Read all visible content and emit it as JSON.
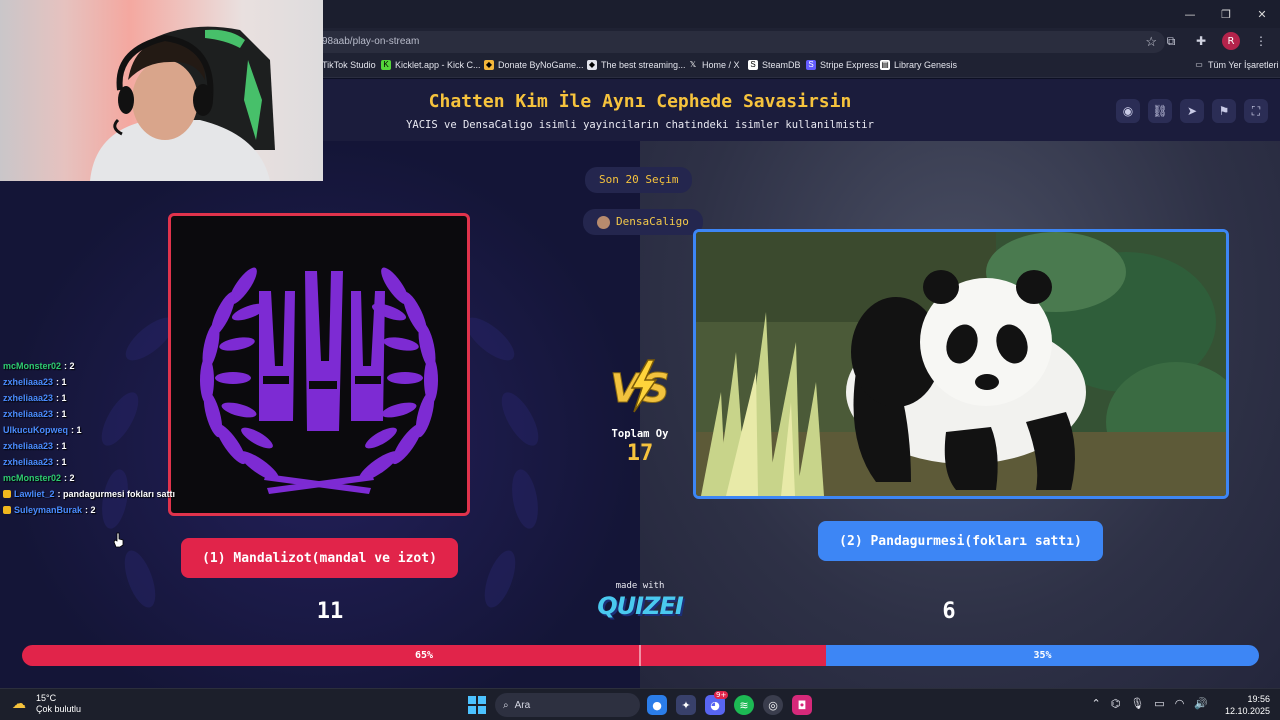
{
  "browser": {
    "url": "98aab/play-on-stream",
    "profile_initial": "R",
    "bookmarks": [
      {
        "label": "TikTok Studio",
        "icon": "tiktok-icon"
      },
      {
        "label": "Kicklet.app - Kick C...",
        "icon": "kicklet-icon"
      },
      {
        "label": "Donate ByNoGame...",
        "icon": "donate-icon"
      },
      {
        "label": "The best streaming...",
        "icon": "streaming-icon"
      },
      {
        "label": "Home / X",
        "icon": "x-icon"
      },
      {
        "label": "SteamDB",
        "icon": "steamdb-icon"
      },
      {
        "label": "Stripe Express",
        "icon": "stripe-icon"
      },
      {
        "label": "Library Genesis",
        "icon": "library-icon"
      }
    ],
    "all_bookmarks": "Tüm Yer İşaretleri"
  },
  "quiz": {
    "title": "Chatten Kim İle Aynı Cephede Savasirsin",
    "subtitle": "YACIS ve DensaCaligo isimli yayincilarin chatindeki isimler kullanilmistir",
    "last_choices": "Son 20 Seçim",
    "streamer": "DensaCaligo",
    "total_label": "Toplam Oy",
    "total_value": "17",
    "made_with": "made with",
    "brand": "QUIZEI",
    "left": {
      "label": "(1) Mandalizot(mandal ve izot)",
      "count": "11",
      "percent_label": "65%",
      "share": 0.65,
      "color": "#e1244a"
    },
    "right": {
      "label": "(2) Pandagurmesi(fokları sattı)",
      "count": "6",
      "percent_label": "35%",
      "share": 0.35,
      "color": "#3d86f5"
    }
  },
  "chat": [
    {
      "user": "mcMonster02",
      "msg": ": 2",
      "color": "#2ecc71",
      "badge": false
    },
    {
      "user": "zxheliaaa23",
      "msg": ": 1",
      "color": "#4a8cff",
      "badge": false
    },
    {
      "user": "zxheliaaa23",
      "msg": ": 1",
      "color": "#4a8cff",
      "badge": false
    },
    {
      "user": "zxheliaaa23",
      "msg": ": 1",
      "color": "#4a8cff",
      "badge": false
    },
    {
      "user": "UlkucuKopweq",
      "msg": ": 1",
      "color": "#4a8cff",
      "badge": false
    },
    {
      "user": "zxheliaaa23",
      "msg": ": 1",
      "color": "#4a8cff",
      "badge": false
    },
    {
      "user": "zxheliaaa23",
      "msg": ": 1",
      "color": "#4a8cff",
      "badge": false
    },
    {
      "user": "mcMonster02",
      "msg": ": 2",
      "color": "#2ecc71",
      "badge": false
    },
    {
      "user": "Lawliet_2",
      "msg": ": pandagurmesi fokları sattı",
      "color": "#4a8cff",
      "badge": true
    },
    {
      "user": "SuleymanBurak",
      "msg": ": 2",
      "color": "#4a8cff",
      "badge": true
    }
  ],
  "taskbar": {
    "temp": "15°C",
    "weather": "Çok bulutlu",
    "search_placeholder": "Ara",
    "time": "19:56",
    "date": "12.10.2025",
    "notification_count": "9+"
  }
}
